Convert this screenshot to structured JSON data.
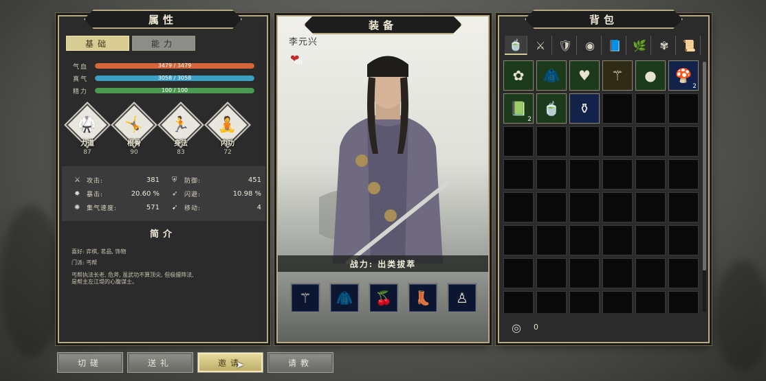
{
  "attributes": {
    "title": "属性",
    "tabs": [
      "基础",
      "能力"
    ],
    "bars": [
      {
        "label": "气血",
        "value": "3479 / 3479",
        "color": "#d8643a",
        "fill_pct": 100
      },
      {
        "label": "真气",
        "value": "3058 / 3058",
        "color": "#3c9fc4",
        "fill_pct": 100
      },
      {
        "label": "精力",
        "value": "100 / 100",
        "color": "#4a9a52",
        "fill_pct": 100
      }
    ],
    "skills": [
      {
        "name": "力道",
        "value": "87",
        "icon": "strength-icon"
      },
      {
        "name": "根骨",
        "value": "90",
        "icon": "constitution-icon"
      },
      {
        "name": "身法",
        "value": "83",
        "icon": "agility-icon"
      },
      {
        "name": "内功",
        "value": "72",
        "icon": "inner-power-icon"
      }
    ],
    "stats": [
      {
        "icon": "attack-icon",
        "label": "攻击:",
        "value": "381"
      },
      {
        "icon": "defense-icon",
        "label": "防御:",
        "value": "451"
      },
      {
        "icon": "crit-icon",
        "label": "暴击:",
        "value": "20.60 %"
      },
      {
        "icon": "dodge-icon",
        "label": "闪避:",
        "value": "10.98 %"
      },
      {
        "icon": "qi-speed-icon",
        "label": "集气速度:",
        "value": "571"
      },
      {
        "icon": "move-icon",
        "label": "移动:",
        "value": "4"
      }
    ],
    "intro_title": "简介",
    "intro_lines": [
      "喜好: 弈棋, 茗品, 饰物",
      "门派: 丐帮",
      "丐帮执法长老, 危斧, 虽武功不算顶尖, 但极擅阵法,",
      "是帮主左江堤的心腹谋士。"
    ]
  },
  "equipment": {
    "title": "装备",
    "character_name": "李元兴",
    "hp_badge": "60",
    "combat_label": "战力: 出类拔萃",
    "slots": [
      {
        "icon": "staff-weapon-icon",
        "glyph": "⚚"
      },
      {
        "icon": "purple-robe-icon",
        "glyph": "🧥"
      },
      {
        "icon": "red-orb-bowl-icon",
        "glyph": "🍒"
      },
      {
        "icon": "boots-icon",
        "glyph": "👢"
      },
      {
        "icon": "jade-figurine-icon",
        "glyph": "♙"
      }
    ]
  },
  "bag": {
    "title": "背包",
    "tabs": [
      {
        "icon": "all-items-icon",
        "glyph": "🍵"
      },
      {
        "icon": "weapon-tab-icon",
        "glyph": "⚔"
      },
      {
        "icon": "armor-tab-icon",
        "glyph": "🛡"
      },
      {
        "icon": "accessory-tab-icon",
        "glyph": "◉"
      },
      {
        "icon": "book-tab-icon",
        "glyph": "📘"
      },
      {
        "icon": "herb-tab-icon",
        "glyph": "🌿"
      },
      {
        "icon": "material-tab-icon",
        "glyph": "✾"
      },
      {
        "icon": "misc-tab-icon",
        "glyph": "📜"
      }
    ],
    "items": [
      {
        "icon": "flower-pastry-icon",
        "glyph": "✿",
        "bg": "#1c3a1c",
        "count": ""
      },
      {
        "icon": "purple-robe-icon",
        "glyph": "🧥",
        "bg": "#1c3a1c",
        "count": ""
      },
      {
        "icon": "red-pendant-icon",
        "glyph": "♥",
        "bg": "#1c3a1c",
        "count": ""
      },
      {
        "icon": "golden-staff-icon",
        "glyph": "⚚",
        "bg": "#2e2a14",
        "count": ""
      },
      {
        "icon": "red-orb-icon",
        "glyph": "●",
        "bg": "#1c3a1c",
        "count": ""
      },
      {
        "icon": "mushroom-icon",
        "glyph": "🍄",
        "bg": "#13224a",
        "count": "2"
      },
      {
        "icon": "green-book-icon",
        "glyph": "📗",
        "bg": "#1c3a1c",
        "count": "2"
      },
      {
        "icon": "green-bowl-icon",
        "glyph": "🍵",
        "bg": "#1c3a1c",
        "count": ""
      },
      {
        "icon": "wine-jar-icon",
        "glyph": "⚱",
        "bg": "#13224a",
        "count": ""
      }
    ],
    "money": "0"
  },
  "actions": [
    {
      "label": "切磋",
      "active": false
    },
    {
      "label": "送礼",
      "active": false
    },
    {
      "label": "邀请",
      "active": true
    },
    {
      "label": "请教",
      "active": false
    }
  ]
}
